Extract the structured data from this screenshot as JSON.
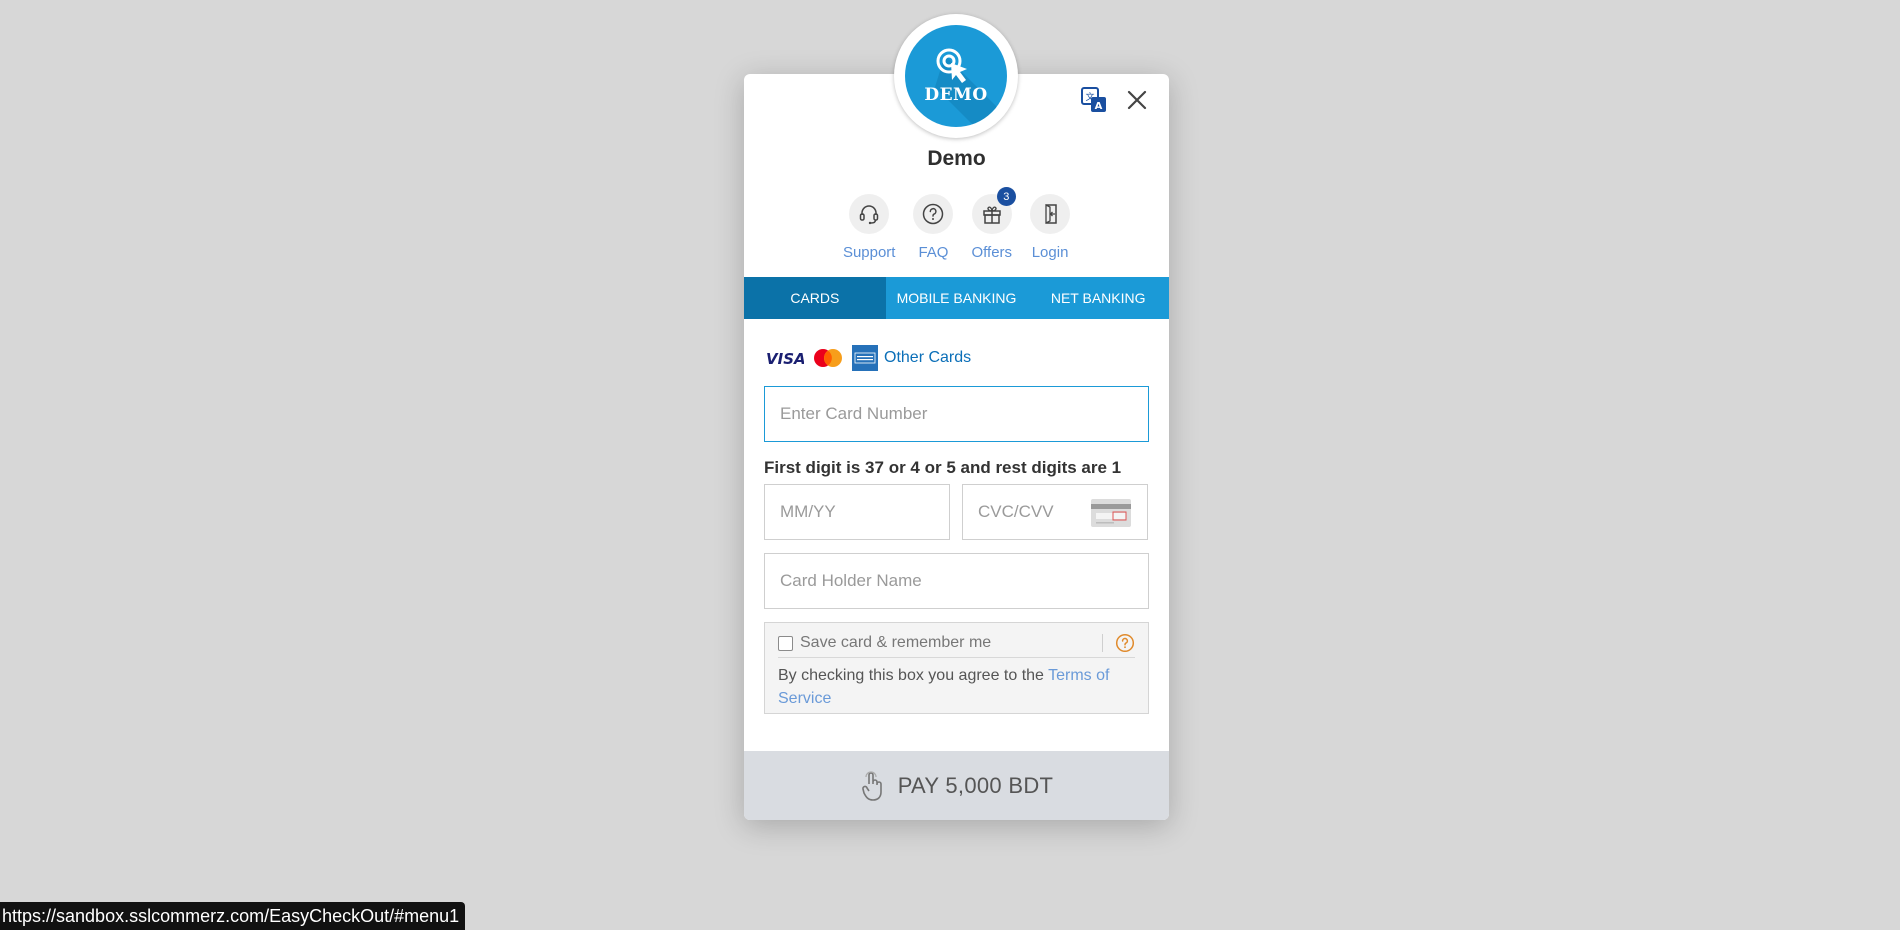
{
  "merchant": {
    "logo_text": "DEMO",
    "name": "Demo"
  },
  "header": {
    "language_icon": "translate-icon",
    "close_icon": "close-icon"
  },
  "quick_links": [
    {
      "label": "Support",
      "icon": "headset-icon"
    },
    {
      "label": "FAQ",
      "icon": "question-circle-icon"
    },
    {
      "label": "Offers",
      "icon": "gift-icon",
      "badge": "3"
    },
    {
      "label": "Login",
      "icon": "login-icon"
    }
  ],
  "tabs": [
    {
      "label": "CARDS",
      "active": true
    },
    {
      "label": "MOBILE BANKING",
      "active": false
    },
    {
      "label": "NET BANKING",
      "active": false
    }
  ],
  "card_form": {
    "brands": [
      "visa",
      "mastercard",
      "amex"
    ],
    "other_cards_label": "Other Cards",
    "card_number_placeholder": "Enter Card Number",
    "hint": "First digit is 37 or 4 or 5 and rest digits are 1",
    "expiry_placeholder": "MM/YY",
    "cvc_placeholder": "CVC/CVV",
    "holder_placeholder": "Card Holder Name",
    "save_label": "Save card & remember me",
    "save_checked": false,
    "terms_prefix": "By checking this box you agree to the ",
    "terms_link": "Terms of Service"
  },
  "pay_button": {
    "label": "PAY 5,000 BDT"
  },
  "colors": {
    "accent": "#1b9ad7",
    "tab_active": "#0b72a8",
    "link": "#5b8fd6"
  },
  "status_bar": {
    "url": "https://sandbox.sslcommerz.com/EasyCheckOut/#menu1"
  }
}
